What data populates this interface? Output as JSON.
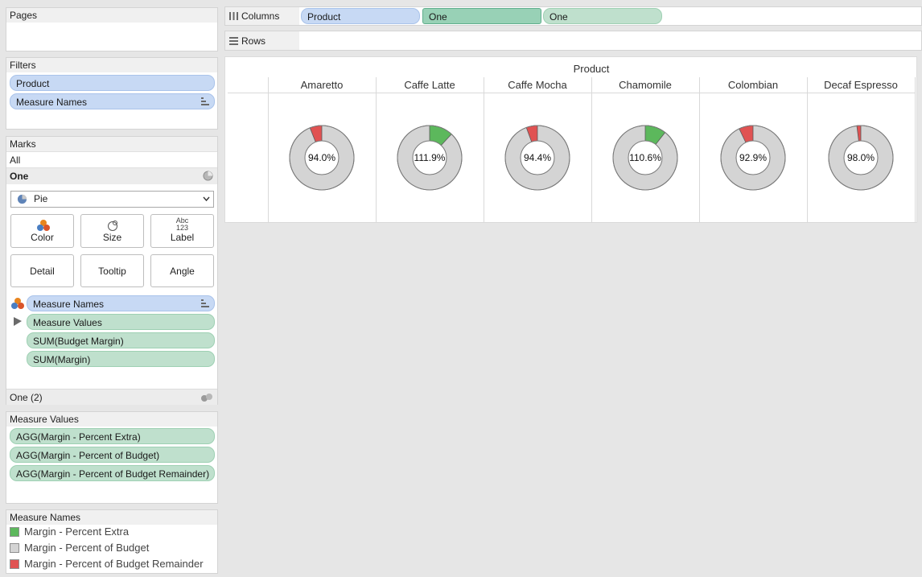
{
  "pages": {
    "title": "Pages"
  },
  "filters": {
    "title": "Filters",
    "items": [
      "Product",
      "Measure Names"
    ]
  },
  "marks": {
    "title": "Marks",
    "all_label": "All",
    "card_label": "One",
    "mark_type": "Pie",
    "buttons": {
      "color": "Color",
      "size": "Size",
      "label": "Label",
      "detail": "Detail",
      "tooltip": "Tooltip",
      "angle": "Angle",
      "label_icon_text_top": "Abc",
      "label_icon_text_bottom": "123"
    },
    "fields": [
      "Measure Names",
      "Measure Values",
      "SUM(Budget Margin)",
      "SUM(Margin)"
    ],
    "second_card_label": "One (2)"
  },
  "measure_values": {
    "title": "Measure Values",
    "items": [
      "AGG(Margin - Percent Extra)",
      "AGG(Margin - Percent of Budget)",
      "AGG(Margin - Percent of Budget Remainder)"
    ]
  },
  "measure_names_legend": {
    "title": "Measure Names",
    "items": [
      {
        "label": "Margin - Percent Extra",
        "color": "#5cb85c"
      },
      {
        "label": "Margin - Percent of Budget",
        "color": "#d4d4d4"
      },
      {
        "label": "Margin - Percent of Budget Remainder",
        "color": "#e05252"
      }
    ]
  },
  "columns_shelf": {
    "label": "Columns",
    "pills": [
      "Product",
      "One",
      "One"
    ]
  },
  "rows_shelf": {
    "label": "Rows"
  },
  "view": {
    "header": "Product",
    "products": [
      {
        "name": "Amaretto",
        "label": "94.0%",
        "kind": "remainder",
        "fraction": 0.06
      },
      {
        "name": "Caffe Latte",
        "label": "111.9%",
        "kind": "extra",
        "fraction": 0.119
      },
      {
        "name": "Caffe Mocha",
        "label": "94.4%",
        "kind": "remainder",
        "fraction": 0.056
      },
      {
        "name": "Chamomile",
        "label": "110.6%",
        "kind": "extra",
        "fraction": 0.106
      },
      {
        "name": "Colombian",
        "label": "92.9%",
        "kind": "remainder",
        "fraction": 0.071
      },
      {
        "name": "Decaf Espresso",
        "label": "98.0%",
        "kind": "remainder",
        "fraction": 0.02
      }
    ]
  },
  "colors": {
    "extra": "#5cb85c",
    "budget": "#d4d4d4",
    "remainder": "#e05252",
    "pill_blue": "#c7d9f4",
    "pill_green": "#bfe0cd"
  }
}
